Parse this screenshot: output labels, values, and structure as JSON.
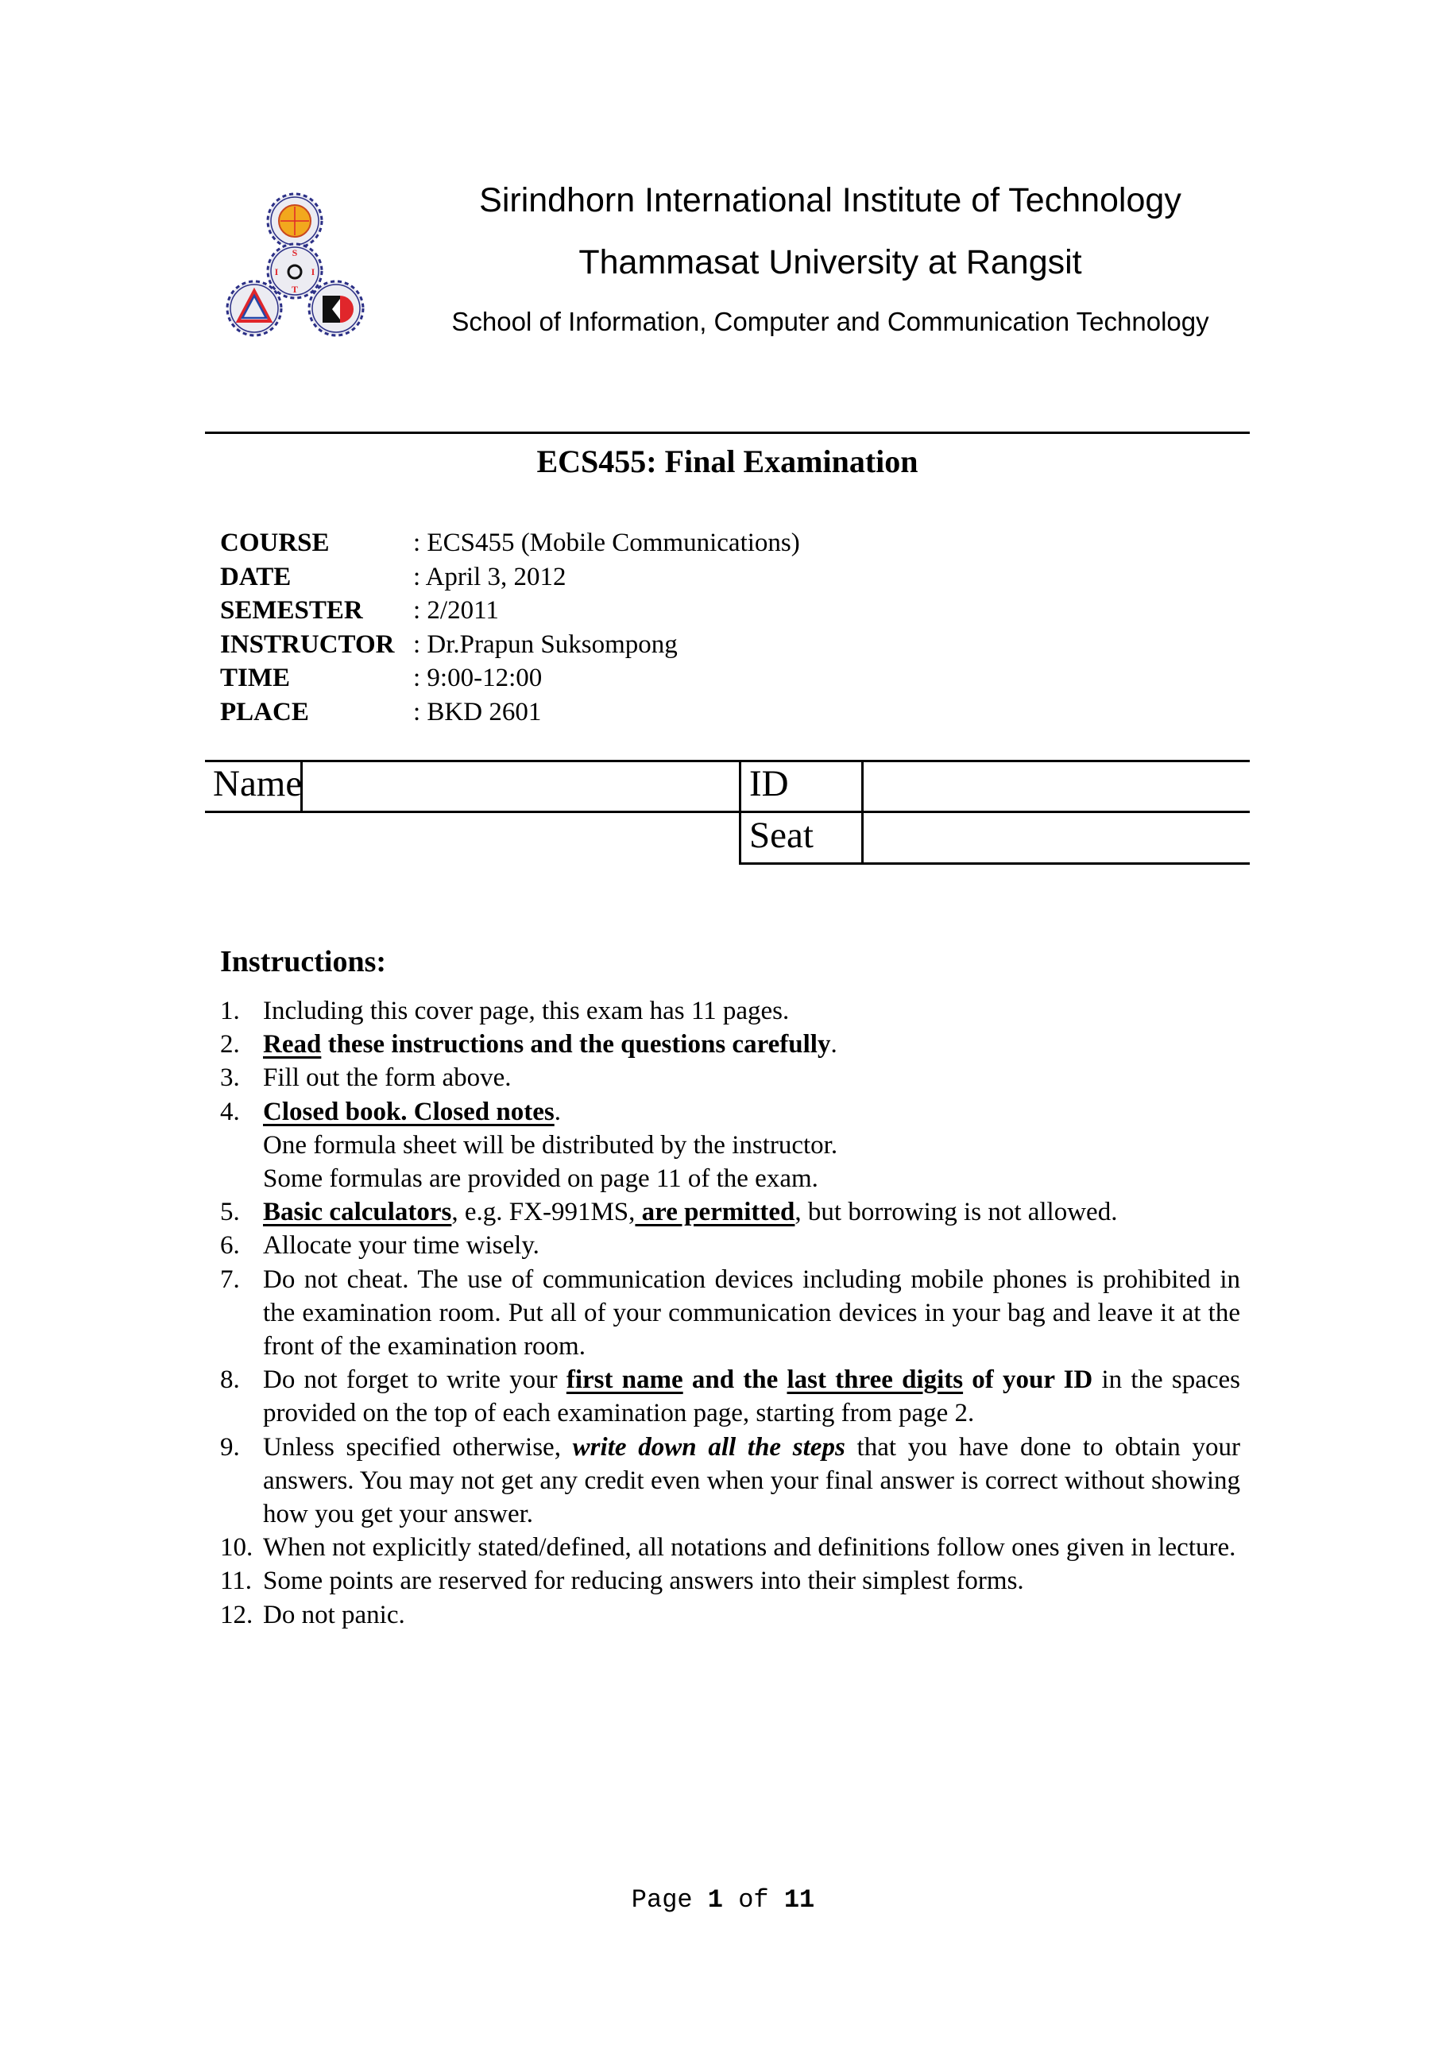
{
  "header": {
    "institute": "Sirindhorn International Institute of Technology",
    "university": "Thammasat University at Rangsit",
    "school": "School of Information, Computer and Communication Technology",
    "logo": {
      "icon": "siit-gears-logo-icon",
      "letters": [
        "S",
        "I",
        "I",
        "T"
      ],
      "colors": {
        "gear": "#2b2f86",
        "gold": "#f2a81d",
        "red": "#e0262b",
        "blue": "#2446a8"
      }
    }
  },
  "exam_title": "ECS455: Final Examination",
  "info": [
    {
      "label": "COURSE",
      "value": ": ECS455 (Mobile Communications)"
    },
    {
      "label": "DATE",
      "value": ": April 3, 2012"
    },
    {
      "label": "SEMESTER",
      "value": ": 2/2011"
    },
    {
      "label": "INSTRUCTOR",
      "value": ": Dr.Prapun Suksompong"
    },
    {
      "label": "TIME",
      "value": ": 9:00-12:00"
    },
    {
      "label": "PLACE",
      "value": ": BKD 2601"
    }
  ],
  "form": {
    "name_label": "Name",
    "name_value": "",
    "id_label": "ID",
    "id_value": "",
    "seat_label": "Seat",
    "seat_value": ""
  },
  "instructions": {
    "heading": "Instructions:",
    "items": [
      {
        "num": "1.",
        "segments": [
          {
            "t": "Including this cover page, this exam has 11 pages."
          }
        ]
      },
      {
        "num": "2.",
        "segments": [
          {
            "t": "Read",
            "s": "bu"
          },
          {
            "t": " these instructions and the questions carefully",
            "s": "b"
          },
          {
            "t": "."
          }
        ]
      },
      {
        "num": "3.",
        "segments": [
          {
            "t": "Fill out the form above."
          }
        ]
      },
      {
        "num": "4.",
        "segments": [
          {
            "t": "Closed book. Closed notes",
            "s": "bu"
          },
          {
            "t": "."
          }
        ],
        "extra_lines": [
          "One formula sheet will be distributed by the instructor.",
          "Some formulas are provided on page 11 of the exam."
        ]
      },
      {
        "num": "5.",
        "segments": [
          {
            "t": "Basic calculators",
            "s": "bu"
          },
          {
            "t": ", e.g. FX-991MS,"
          },
          {
            "t": " are permitted",
            "s": "bu"
          },
          {
            "t": ", but borrowing is not allowed."
          }
        ]
      },
      {
        "num": "6.",
        "segments": [
          {
            "t": "Allocate your time wisely."
          }
        ]
      },
      {
        "num": "7.",
        "segments": [
          {
            "t": "Do not cheat. The use of communication devices including mobile phones is prohibited in the examination room. Put all of your communication devices in your bag and leave it at the front of the examination room."
          }
        ]
      },
      {
        "num": "8.",
        "segments": [
          {
            "t": "Do not forget to write your "
          },
          {
            "t": "first name",
            "s": "bu"
          },
          {
            "t": " and the ",
            "s": "b"
          },
          {
            "t": "last three digits",
            "s": "bu"
          },
          {
            "t": " of your ID",
            "s": "b"
          },
          {
            "t": " in the spaces provided on the top of each examination page, starting from page 2."
          }
        ]
      },
      {
        "num": "9.",
        "segments": [
          {
            "t": "Unless specified otherwise, "
          },
          {
            "t": "write down all the steps",
            "s": "bi"
          },
          {
            "t": " that you have done to obtain your answers. You may not get any credit even when your final answer is correct without showing how you get your answer."
          }
        ]
      },
      {
        "num": "10.",
        "segments": [
          {
            "t": "When not explicitly stated/defined, all notations and definitions follow ones given in lecture."
          }
        ]
      },
      {
        "num": "11.",
        "segments": [
          {
            "t": "Some points are reserved for reducing answers into their simplest forms."
          }
        ]
      },
      {
        "num": "12.",
        "segments": [
          {
            "t": "Do not panic."
          }
        ]
      }
    ]
  },
  "footer": {
    "page_word": "Page",
    "current_page": "1",
    "of_word": "of",
    "total_pages": "11"
  }
}
